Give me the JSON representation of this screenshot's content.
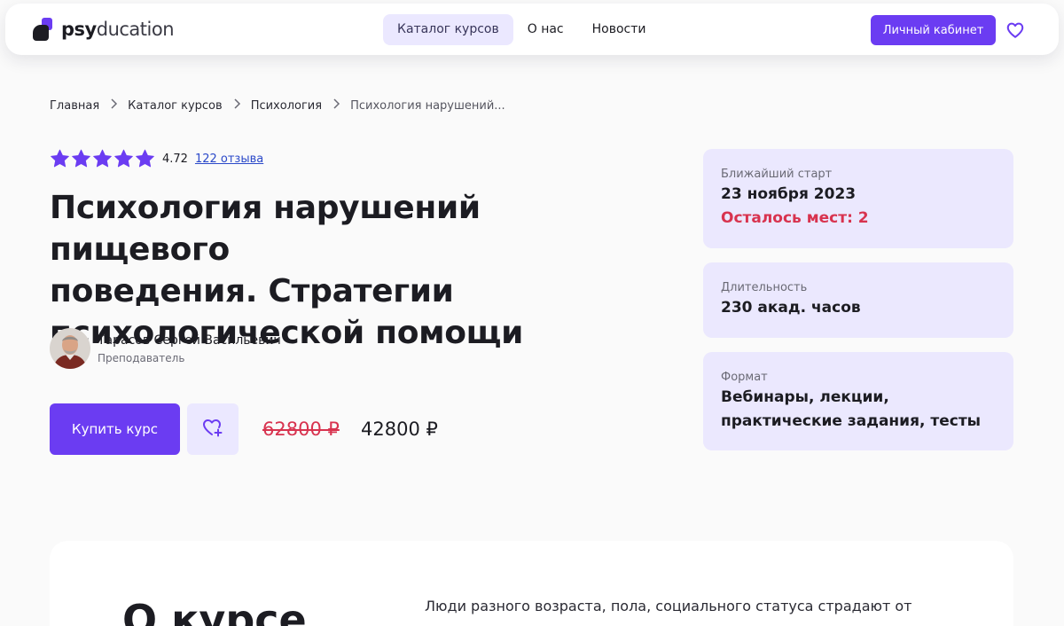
{
  "header": {
    "logo": {
      "part1": "psy",
      "part2": "ducation"
    },
    "nav": [
      {
        "label": "Каталог курсов",
        "active": true
      },
      {
        "label": "О нас",
        "active": false
      },
      {
        "label": "Новости",
        "active": false
      }
    ],
    "cabinet_label": "Личный кабинет",
    "icons": {
      "favorites": "heart-outline-icon"
    }
  },
  "breadcrumb": {
    "items": [
      "Главная",
      "Каталог курсов",
      "Психология",
      "Психология нарушений..."
    ]
  },
  "rating": {
    "stars": 5,
    "value": "4.72",
    "reviews": "122 отзыва"
  },
  "course": {
    "title_lines": [
      "Психология нарушений пищевого",
      "поведения. Стратегии",
      "психологической помощи"
    ]
  },
  "teacher": {
    "name": "Тарасов Сергей Васильевич",
    "role": "Преподаватель"
  },
  "purchase": {
    "buy_label": "Купить курс",
    "old_price": "62800 ₽",
    "new_price": "42800 ₽",
    "icons": {
      "add_favorite": "heart-plus-icon"
    }
  },
  "cards": {
    "start": {
      "label": "Ближайший старт",
      "value": "23 ноября 2023",
      "seats": "Осталось мест: 2"
    },
    "duration": {
      "label": "Длительность",
      "value": "230 акад. часов"
    },
    "format": {
      "label": "Формат",
      "value_lines": [
        "Вебинары, лекции,",
        "практические задания, тесты"
      ]
    }
  },
  "about": {
    "title": "О курсе",
    "text": "Люди разного возраста, пола, социального статуса страдают от"
  },
  "colors": {
    "accent": "#6b3cf2",
    "accent_soft": "#ebe8ff",
    "danger": "#d8334f",
    "link": "#2b49c9"
  }
}
